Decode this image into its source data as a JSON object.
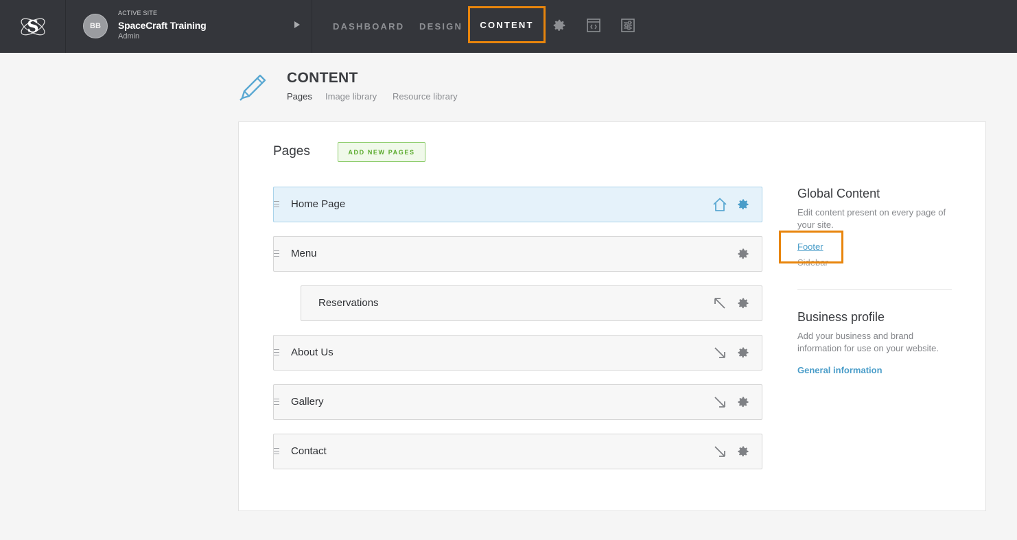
{
  "topbar": {
    "site_label": "ACTIVE SITE",
    "site_name": "SpaceCraft Training",
    "site_role": "Admin",
    "avatar_initials": "BB",
    "nav": [
      {
        "label": "DASHBOARD"
      },
      {
        "label": "DESIGN"
      },
      {
        "label": "CONTENT",
        "active": true
      }
    ],
    "icons": [
      "gear-icon",
      "code-window-icon",
      "sliders-icon"
    ]
  },
  "header": {
    "title": "CONTENT",
    "tabs": [
      {
        "label": "Pages",
        "active": true
      },
      {
        "label": "Image library"
      },
      {
        "label": "Resource library"
      }
    ]
  },
  "pages": {
    "heading": "Pages",
    "add_button": "ADD NEW PAGES",
    "items": [
      {
        "label": "Home Page",
        "icon": "home-icon",
        "level": 0
      },
      {
        "label": "Menu",
        "icon": "",
        "level": 0
      },
      {
        "label": "Reservations",
        "icon": "outdent-arrow-icon",
        "level": 1
      },
      {
        "label": "About Us",
        "icon": "indent-arrow-icon",
        "level": 0
      },
      {
        "label": "Gallery",
        "icon": "indent-arrow-icon",
        "level": 0
      },
      {
        "label": "Contact",
        "icon": "indent-arrow-icon",
        "level": 0
      }
    ]
  },
  "global_content": {
    "title": "Global Content",
    "description": "Edit content present on every page of your site.",
    "links": [
      "Footer",
      "Sidebar"
    ]
  },
  "business_profile": {
    "title": "Business profile",
    "description": "Add your business and brand information for use on your website.",
    "link": "General information"
  },
  "colors": {
    "topbar": "#34363b",
    "accent_highlight": "#e8850c",
    "link": "#4a9dc9",
    "add_button": "#5aaa2c"
  }
}
